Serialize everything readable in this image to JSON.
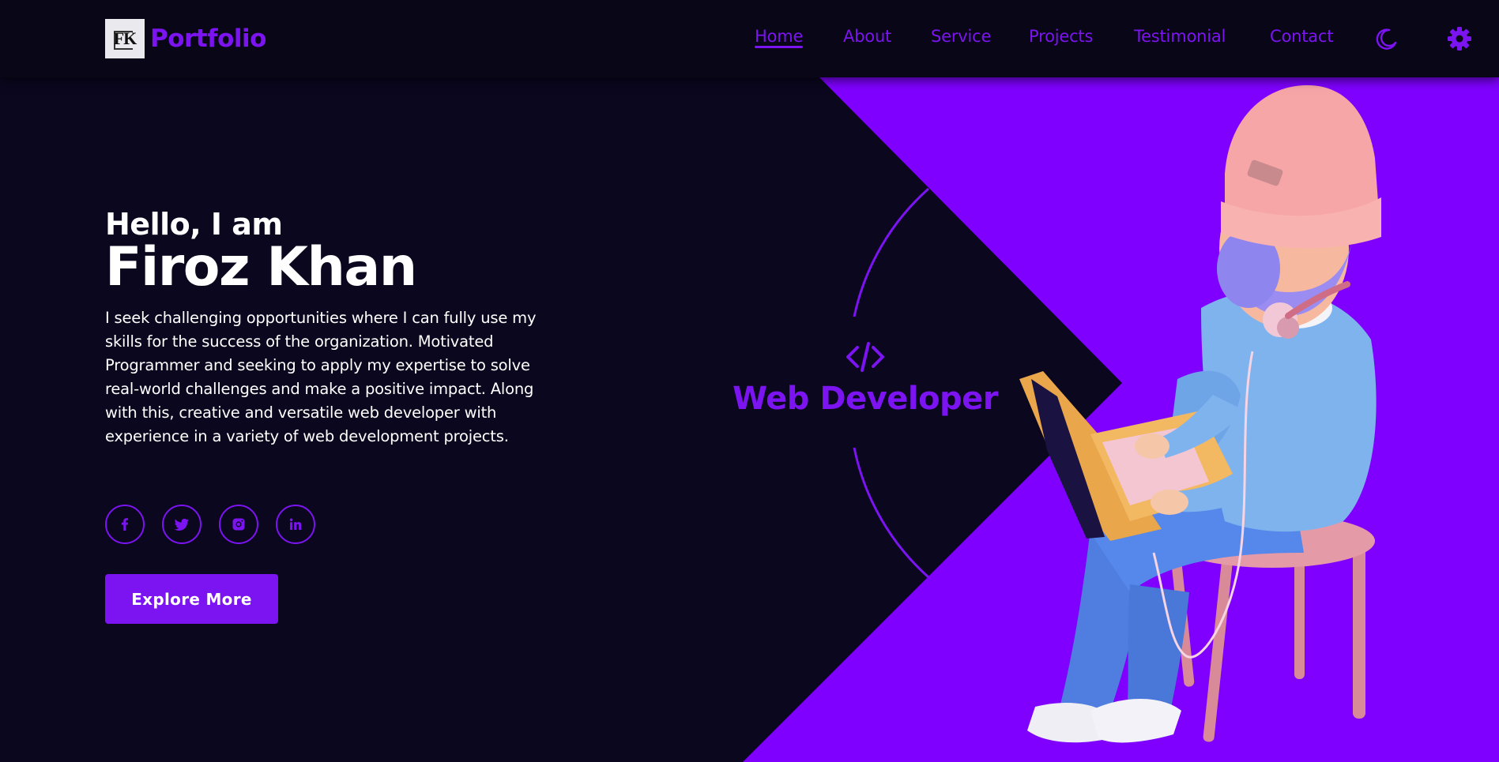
{
  "brand": {
    "logo_text": "FK",
    "name": "Portfolio"
  },
  "nav": {
    "items": [
      {
        "label": "Home",
        "active": true
      },
      {
        "label": "About",
        "active": false
      },
      {
        "label": "Service",
        "active": false
      },
      {
        "label": "Projects",
        "active": false
      },
      {
        "label": "Testimonial",
        "active": false
      },
      {
        "label": "Contact",
        "active": false
      }
    ],
    "theme_icon": "moon-icon",
    "settings_icon": "gear-icon"
  },
  "hero": {
    "greeting": "Hello, I am",
    "name": "Firoz Khan",
    "description": "I seek challenging opportunities where I can fully use my skills for the success of the organization. Motivated Programmer and seeking to apply my expertise to solve real-world challenges and make a positive impact. Along with this, creative and versatile web developer with experience in a variety of web development projects.",
    "cta_label": "Explore More"
  },
  "socials": [
    {
      "name": "facebook",
      "icon": "facebook-icon"
    },
    {
      "name": "twitter",
      "icon": "twitter-icon"
    },
    {
      "name": "instagram",
      "icon": "instagram-icon"
    },
    {
      "name": "linkedin",
      "icon": "linkedin-icon"
    }
  ],
  "role": {
    "icon": "code-icon",
    "title": "Web Developer"
  },
  "colors": {
    "background": "#0a071e",
    "navbar": "#090618",
    "accent": "#7b14f0",
    "panel": "#7f00ff",
    "text": "#ffffff"
  }
}
